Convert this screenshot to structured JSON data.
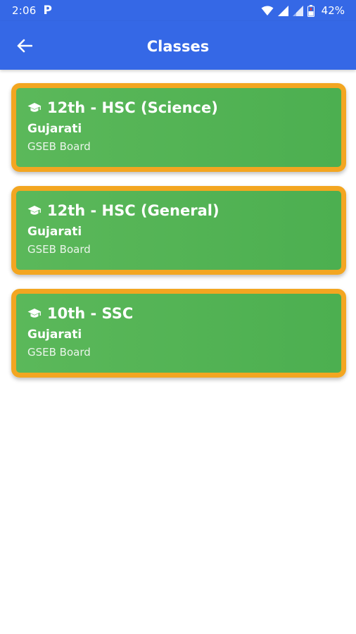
{
  "status_bar": {
    "time": "2:06",
    "app_icon": "P",
    "icons": [
      "wifi-icon",
      "signal-icon",
      "signal-icon",
      "battery-icon"
    ],
    "battery": "42%"
  },
  "app_bar": {
    "back_icon": "arrow-left-icon",
    "title": "Classes"
  },
  "classes": [
    {
      "icon": "graduation-cap-icon",
      "title": "12th - HSC (Science)",
      "language": "Gujarati",
      "board": "GSEB Board"
    },
    {
      "icon": "graduation-cap-icon",
      "title": "12th - HSC (General)",
      "language": "Gujarati",
      "board": "GSEB Board"
    },
    {
      "icon": "graduation-cap-icon",
      "title": "10th - SSC",
      "language": "Gujarati",
      "board": "GSEB Board"
    }
  ],
  "colors": {
    "primary": "#3568e6",
    "card_green": "#4caf50",
    "card_border": "#f3a621"
  }
}
